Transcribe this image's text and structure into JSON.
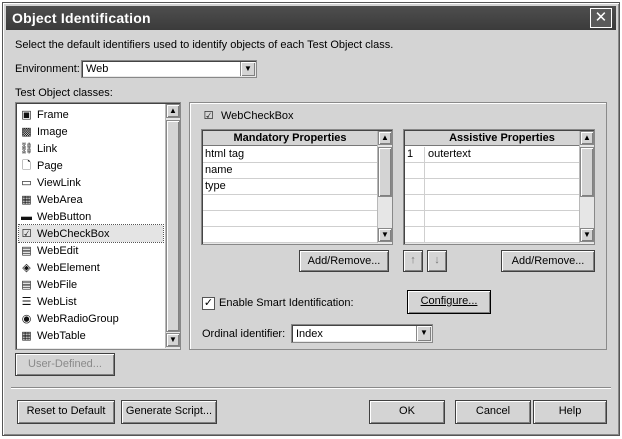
{
  "window": {
    "title": "Object Identification",
    "close_glyph": "✕"
  },
  "instruction": "Select the default identifiers used to identify objects of each Test Object class.",
  "environment": {
    "label": "Environment:",
    "value": "Web"
  },
  "classes": {
    "label": "Test Object classes:",
    "items": [
      {
        "label": "Frame",
        "icon": "frame-icon",
        "glyph": "▣"
      },
      {
        "label": "Image",
        "icon": "image-icon",
        "glyph": "▩"
      },
      {
        "label": "Link",
        "icon": "link-icon",
        "glyph": "⛓"
      },
      {
        "label": "Page",
        "icon": "page-icon",
        "glyph": "🗋"
      },
      {
        "label": "ViewLink",
        "icon": "viewlink-icon",
        "glyph": "▭"
      },
      {
        "label": "WebArea",
        "icon": "webarea-icon",
        "glyph": "▦"
      },
      {
        "label": "WebButton",
        "icon": "webbutton-icon",
        "glyph": "▬"
      },
      {
        "label": "WebCheckBox",
        "icon": "webcheckbox-icon",
        "glyph": "☑"
      },
      {
        "label": "WebEdit",
        "icon": "webedit-icon",
        "glyph": "▤"
      },
      {
        "label": "WebElement",
        "icon": "webelement-icon",
        "glyph": "◈"
      },
      {
        "label": "WebFile",
        "icon": "webfile-icon",
        "glyph": "▤"
      },
      {
        "label": "WebList",
        "icon": "weblist-icon",
        "glyph": "☰"
      },
      {
        "label": "WebRadioGroup",
        "icon": "webradiogroup-icon",
        "glyph": "◉"
      },
      {
        "label": "WebTable",
        "icon": "webtable-icon",
        "glyph": "▦"
      }
    ],
    "selected": "WebCheckBox"
  },
  "selected_class": {
    "label": "WebCheckBox",
    "glyph": "☑"
  },
  "mandatory": {
    "header": "Mandatory Properties",
    "rows": [
      "html tag",
      "name",
      "type",
      "",
      "",
      ""
    ]
  },
  "assistive": {
    "header": "Assistive Properties",
    "rows": [
      {
        "num": "1",
        "value": "outertext"
      },
      {
        "num": "",
        "value": ""
      },
      {
        "num": "",
        "value": ""
      },
      {
        "num": "",
        "value": ""
      },
      {
        "num": "",
        "value": ""
      },
      {
        "num": "",
        "value": ""
      }
    ]
  },
  "buttons": {
    "add_remove_mandatory": "Add/Remove...",
    "add_remove_assistive": "Add/Remove...",
    "move_up": "↑",
    "move_down": "↓",
    "configure": "Configure...",
    "user_defined": "User-Defined...",
    "reset": "Reset to Default",
    "generate": "Generate Script...",
    "ok": "OK",
    "cancel": "Cancel",
    "help": "Help"
  },
  "smart_identification": {
    "label": "Enable Smart Identification:",
    "checked": true,
    "check_glyph": "✓"
  },
  "ordinal": {
    "label": "Ordinal identifier:",
    "value": "Index"
  }
}
